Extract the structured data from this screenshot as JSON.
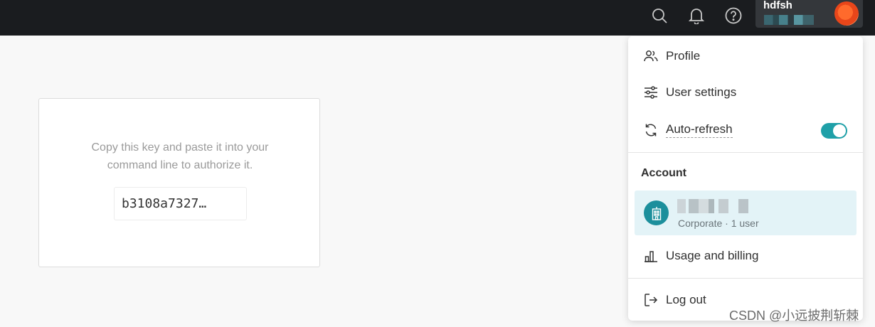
{
  "header": {
    "username": "hdfsh",
    "icons": [
      "search-icon",
      "bell-icon",
      "help-icon"
    ]
  },
  "auth_card": {
    "message_line1": "Copy this key and paste it into your",
    "message_line2": "command line to authorize it.",
    "key": "b3108a7327…"
  },
  "menu": {
    "profile": "Profile",
    "user_settings": "User settings",
    "auto_refresh": "Auto-refresh",
    "auto_refresh_on": true,
    "account_section": "Account",
    "account_sub": "Corporate · 1 user",
    "usage_billing": "Usage and billing",
    "log_out": "Log out"
  },
  "colors": {
    "accent": "#1fa0a8",
    "topbar": "#1a1c1f",
    "account_highlight": "#e3f3f7"
  },
  "watermark": "CSDN @小远披荆斩棘"
}
